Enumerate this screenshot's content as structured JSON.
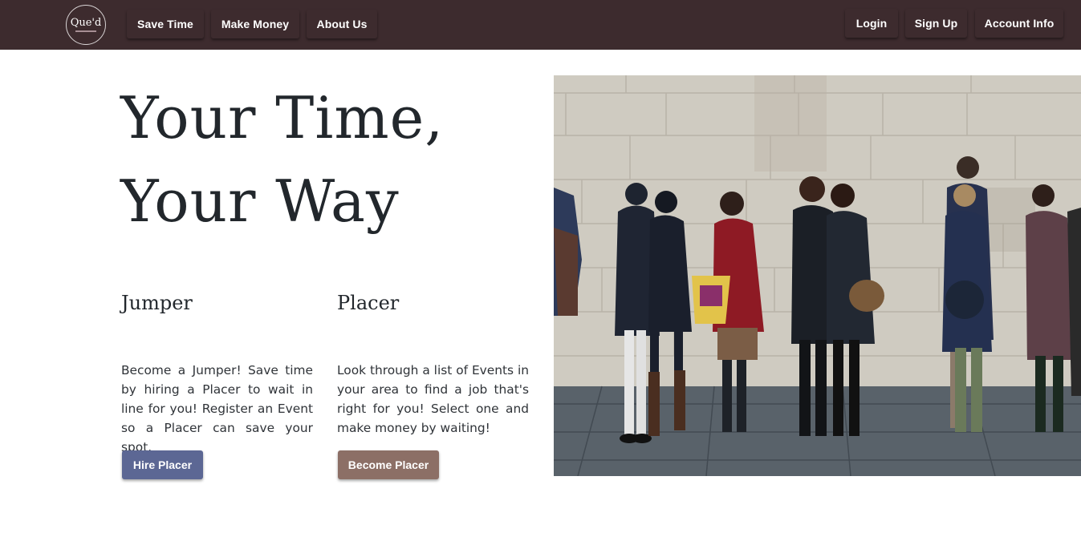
{
  "nav": {
    "logo_text": "Que'd",
    "left_links": [
      "Save Time",
      "Make Money",
      "About Us"
    ],
    "right_links": [
      "Login",
      "Sign Up",
      "Account Info"
    ]
  },
  "hero": {
    "line1": "Your Time,",
    "line2": "Your Way"
  },
  "jumper": {
    "title": "Jumper",
    "text": "Become a Jumper! Save time by hiring a Placer to wait in line for you! Register an Event so a Placer can save your spot.",
    "button": "Hire Placer"
  },
  "placer": {
    "title": "Placer",
    "text": "Look through a list of Events in your area to find a job that's right for you! Select one and make money by waiting!",
    "button": "Become Placer"
  },
  "colors": {
    "navbar": "#3d2b2e",
    "hire_button": "#5c6794",
    "become_button": "#8c6f66"
  }
}
